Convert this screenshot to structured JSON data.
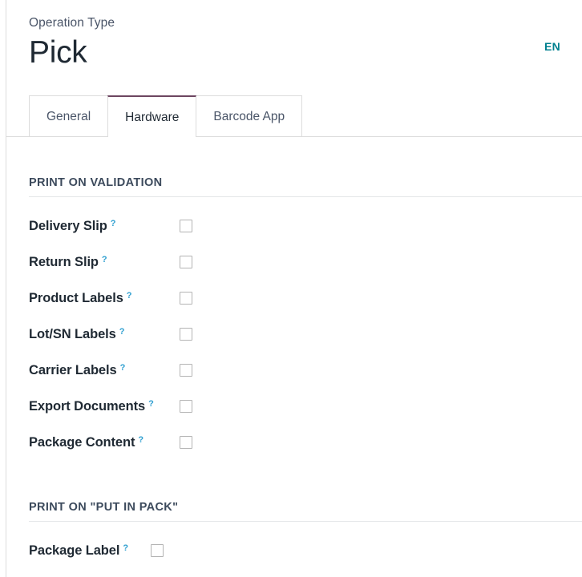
{
  "header": {
    "breadcrumb": "Operation Type",
    "record_title": "Pick",
    "language_badge": "EN"
  },
  "tabs": [
    {
      "label": "General",
      "active": false
    },
    {
      "label": "Hardware",
      "active": true
    },
    {
      "label": "Barcode App",
      "active": false
    }
  ],
  "active_tab": "Hardware",
  "sections": [
    {
      "title": "PRINT ON VALIDATION",
      "label_column": "wide",
      "fields": [
        {
          "label": "Delivery Slip",
          "help": "?",
          "checked": false
        },
        {
          "label": "Return Slip",
          "help": "?",
          "checked": false
        },
        {
          "label": "Product Labels",
          "help": "?",
          "checked": false
        },
        {
          "label": "Lot/SN Labels",
          "help": "?",
          "checked": false
        },
        {
          "label": "Carrier Labels",
          "help": "?",
          "checked": false
        },
        {
          "label": "Export Documents",
          "help": "?",
          "checked": false
        },
        {
          "label": "Package Content",
          "help": "?",
          "checked": false
        }
      ]
    },
    {
      "title": "PRINT ON \"PUT IN PACK\"",
      "label_column": "narrow",
      "fields": [
        {
          "label": "Package Label",
          "help": "?",
          "checked": false
        }
      ]
    }
  ],
  "colors": {
    "accent_tab": "#6d4560",
    "language_badge": "#00808f",
    "help_marker": "#2f9fd0",
    "section_title": "#3c4a5c",
    "title": "#1f2933",
    "border": "#dcdcdc"
  }
}
